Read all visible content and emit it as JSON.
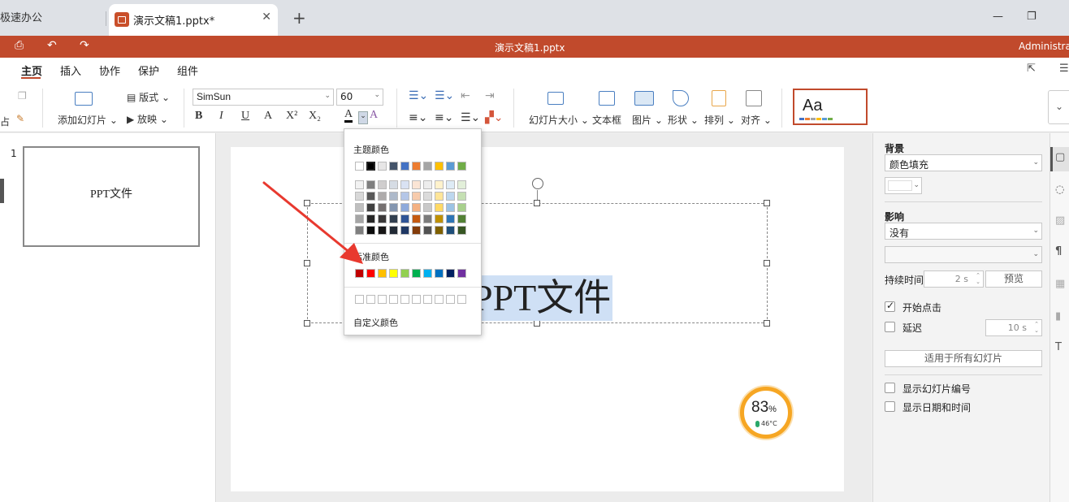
{
  "tabs": {
    "app_tab": "极速办公",
    "doc_tab": "演示文稿1.pptx*",
    "close": "✕",
    "new": "+"
  },
  "window": {
    "minimize": "—",
    "restore": "❐"
  },
  "titlebar": {
    "doc_title": "演示文稿1.pptx",
    "user": "Administrator"
  },
  "menu": {
    "items": [
      "主页",
      "插入",
      "协作",
      "保护",
      "组件"
    ],
    "active": "主页"
  },
  "ribbon": {
    "add_slide": "添加幻灯片",
    "layout": "版式",
    "play": "放映",
    "font_name": "SimSun",
    "font_size": "60",
    "slide_size": "幻灯片大小",
    "textbox": "文本框",
    "picture": "图片",
    "shape": "形状",
    "arrange": "排列",
    "align": "对齐",
    "theme_preview": "Aa",
    "paste_fragment": "占",
    "format_buttons": [
      "B",
      "I",
      "U",
      "A",
      "X²",
      "X₂"
    ],
    "theme_bar_colors": [
      "#4472c4",
      "#ed7d31",
      "#a5a5a5",
      "#ffc000",
      "#5b9bd5",
      "#70ad47"
    ]
  },
  "slides_panel": {
    "slide_number": "1",
    "thumb_text": "PPT文件"
  },
  "slide": {
    "text": "PPT文件"
  },
  "gauge": {
    "percent": "83",
    "percent_unit": "%",
    "temperature": "46°C",
    "accent": "#f6a623"
  },
  "dropdown": {
    "theme_title": "主题颜色",
    "standard_title": "标准颜色",
    "custom_label": "自定义颜色",
    "theme_row": [
      "#ffffff",
      "#000000",
      "#e7e6e6",
      "#44546a",
      "#4472c4",
      "#ed7d31",
      "#a5a5a5",
      "#ffc000",
      "#5b9bd5",
      "#70ad47"
    ],
    "theme_shades": [
      [
        "#f2f2f2",
        "#7f7f7f",
        "#d0cece",
        "#d6dce4",
        "#d9e2f3",
        "#fbe5d5",
        "#ededed",
        "#fff2cc",
        "#deebf6",
        "#e2efd9"
      ],
      [
        "#d8d8d8",
        "#595959",
        "#aeabab",
        "#adb9ca",
        "#b4c6e7",
        "#f7cbac",
        "#dbdbdb",
        "#fee599",
        "#bdd7ee",
        "#c5e0b3"
      ],
      [
        "#bfbfbf",
        "#3f3f3f",
        "#757070",
        "#8496b0",
        "#8eaadb",
        "#f4b183",
        "#c9c9c9",
        "#ffd965",
        "#9cc3e5",
        "#a8d08d"
      ],
      [
        "#a5a5a5",
        "#262626",
        "#3a3838",
        "#323f4f",
        "#2f5496",
        "#c55a11",
        "#7b7b7b",
        "#bf9000",
        "#2e75b5",
        "#538135"
      ],
      [
        "#7f7f7f",
        "#0c0c0c",
        "#171616",
        "#222a35",
        "#1f3864",
        "#833c0b",
        "#525252",
        "#7f6000",
        "#1e4e79",
        "#375623"
      ]
    ],
    "standard_row": [
      "#c00000",
      "#ff0000",
      "#ffc000",
      "#ffff00",
      "#92d050",
      "#00b050",
      "#00b0f0",
      "#0070c0",
      "#002060",
      "#7030a0"
    ]
  },
  "properties": {
    "background_title": "背景",
    "fill_type": "颜色填充",
    "effect_title": "影响",
    "effect_value": "没有",
    "duration_label": "持续时间",
    "duration_value": "2 s",
    "preview": "预览",
    "start_on_click": "开始点击",
    "delay_label": "延迟",
    "delay_value": "10 s",
    "apply_all": "适用于所有幻灯片",
    "show_number": "显示幻灯片编号",
    "show_datetime": "显示日期和时间"
  },
  "colors": {
    "accent": "#c14a2c",
    "arrow": "#e8392f"
  }
}
